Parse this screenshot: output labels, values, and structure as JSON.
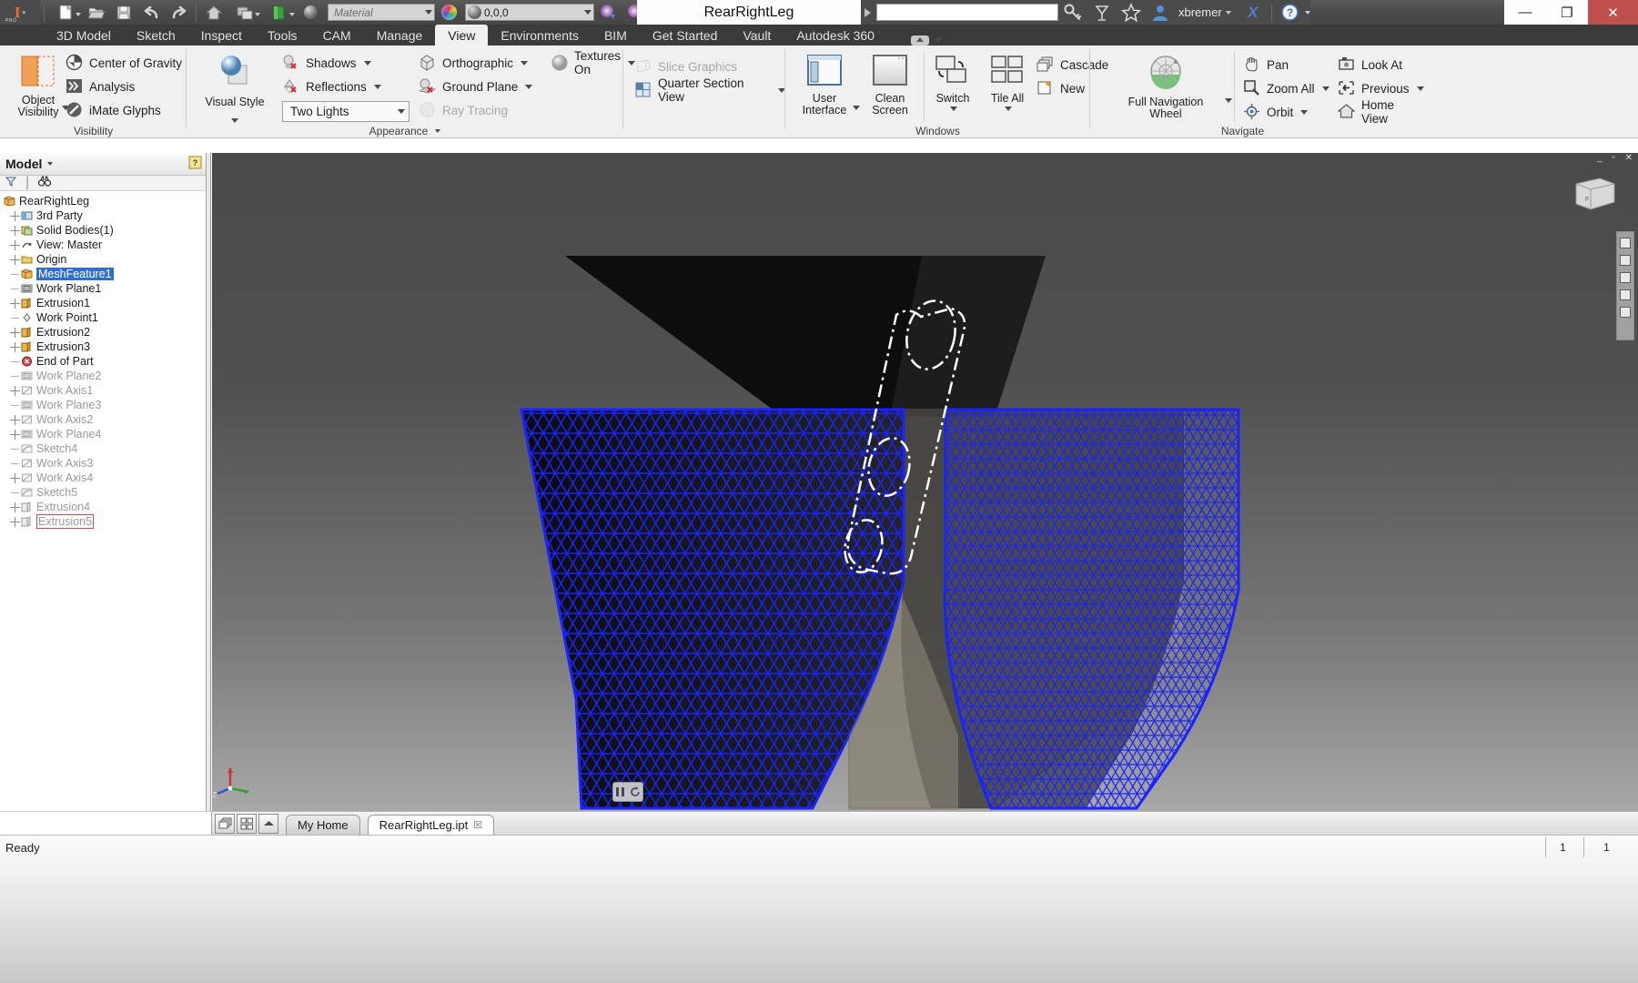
{
  "app": {
    "title": "RearRightLeg",
    "user": "xbremer",
    "status": "Ready"
  },
  "titlebar": {
    "logo": "inventor-logo",
    "logo_text": "I",
    "logo_sub": "PRO",
    "qat": [
      {
        "name": "new-file",
        "icon": "document-icon",
        "dropdown": true
      },
      {
        "name": "open-file",
        "icon": "folder-open-icon",
        "dropdown": false
      },
      {
        "name": "save-file",
        "icon": "floppy-disk-icon",
        "dropdown": false
      },
      {
        "name": "undo",
        "icon": "undo-arrow-icon",
        "dropdown": false
      },
      {
        "name": "redo",
        "icon": "redo-arrow-icon",
        "dropdown": false
      },
      {
        "name": "home",
        "icon": "home-icon",
        "dropdown": false
      },
      {
        "name": "return",
        "icon": "return-icon",
        "dropdown": true
      },
      {
        "name": "update",
        "icon": "green-book-icon",
        "dropdown": true
      },
      {
        "name": "material-sphere",
        "icon": "globe-icon",
        "dropdown": false
      }
    ],
    "material_value": "Material",
    "appearance_value": "0,0,0",
    "adjust_icons": [
      {
        "name": "clear-appearance-override",
        "icon": "color-eyedropper-icon"
      },
      {
        "name": "remove-appearance",
        "icon": "color-x-icon"
      },
      {
        "name": "parameters",
        "icon": "fx-icon"
      },
      {
        "name": "add-to-quick-access",
        "icon": "plus-icon"
      },
      {
        "name": "customize-quick-access",
        "icon": "overflow-icon"
      }
    ],
    "search_placeholder": "",
    "search_value": "",
    "right_icons": [
      {
        "name": "search-icon",
        "icon": "key-icon"
      },
      {
        "name": "connect-icon",
        "icon": "satellite-icon"
      },
      {
        "name": "favorites-icon",
        "icon": "star-icon"
      },
      {
        "name": "account-icon",
        "icon": "person-icon"
      },
      {
        "name": "exchange-apps-icon",
        "icon": "x-logo-icon"
      },
      {
        "name": "help-icon",
        "icon": "question-circle-icon"
      }
    ],
    "window_buttons": {
      "minimize": "—",
      "maximize": "❐",
      "close": "✕"
    }
  },
  "ribbon": {
    "tabs": [
      {
        "label": "3D Model",
        "active": false
      },
      {
        "label": "Sketch",
        "active": false
      },
      {
        "label": "Inspect",
        "active": false
      },
      {
        "label": "Tools",
        "active": false
      },
      {
        "label": "CAM",
        "active": false
      },
      {
        "label": "Manage",
        "active": false
      },
      {
        "label": "View",
        "active": true
      },
      {
        "label": "Environments",
        "active": false
      },
      {
        "label": "BIM",
        "active": false
      },
      {
        "label": "Get Started",
        "active": false
      },
      {
        "label": "Vault",
        "active": false
      },
      {
        "label": "Autodesk 360",
        "active": false
      }
    ],
    "panels": [
      {
        "name": "visibility",
        "label": "Visibility",
        "big_button": {
          "line1": "Object",
          "line2": "Visibility",
          "icon": "object-visibility-icon",
          "dropdown": true
        },
        "items": [
          {
            "label": "Center of Gravity",
            "icon": "center-of-gravity-icon",
            "dropdown": false,
            "disabled": false
          },
          {
            "label": "Analysis",
            "icon": "analysis-icon",
            "dropdown": false,
            "disabled": false
          },
          {
            "label": "iMate Glyphs",
            "icon": "imate-glyphs-icon",
            "dropdown": false,
            "disabled": false
          }
        ]
      },
      {
        "name": "appearance",
        "label": "Appearance",
        "label_dropdown": true,
        "big_button": {
          "line1": "Visual Style",
          "line2": "",
          "icon": "visual-style-icon",
          "dropdown": true
        },
        "items": [
          {
            "label": "Shadows",
            "icon": "shadows-icon",
            "dropdown": true,
            "disabled": false
          },
          {
            "label": "Reflections",
            "icon": "reflections-icon",
            "dropdown": true,
            "disabled": false
          },
          {
            "label": "Orthographic",
            "icon": "orthographic-icon",
            "dropdown": true,
            "disabled": false
          },
          {
            "label": "Ground Plane",
            "icon": "ground-plane-icon",
            "dropdown": true,
            "disabled": false
          },
          {
            "label": "Textures On",
            "icon": "textures-icon",
            "dropdown": true,
            "disabled": false
          },
          {
            "label": "Ray Tracing",
            "icon": "ray-tracing-icon",
            "dropdown": false,
            "disabled": true
          }
        ],
        "lights_combo": "Two Lights"
      },
      {
        "name": "sectioning",
        "label": "",
        "items": [
          {
            "label": "Slice Graphics",
            "icon": "slice-graphics-icon",
            "dropdown": false,
            "disabled": true
          },
          {
            "label": "Quarter Section View",
            "icon": "quarter-section-view-icon",
            "dropdown": true,
            "disabled": false
          }
        ]
      },
      {
        "name": "windows",
        "label": "Windows",
        "big_buttons": [
          {
            "line1": "User",
            "line2": "Interface",
            "icon": "user-interface-icon",
            "dropdown": true
          },
          {
            "line1": "Clean",
            "line2": "Screen",
            "icon": "clean-screen-icon",
            "dropdown": false
          },
          {
            "line1": "Switch",
            "line2": "",
            "icon": "switch-windows-icon",
            "dropdown": true
          },
          {
            "line1": "Tile All",
            "line2": "",
            "icon": "tile-all-icon",
            "dropdown": true
          }
        ],
        "items": [
          {
            "label": "Cascade",
            "icon": "cascade-icon",
            "dropdown": false,
            "disabled": false
          },
          {
            "label": "New",
            "icon": "new-window-icon",
            "dropdown": false,
            "disabled": false
          }
        ]
      },
      {
        "name": "navigate",
        "label": "Navigate",
        "big_button": {
          "line1": "Full Navigation",
          "line2": "Wheel",
          "icon": "navigation-wheel-icon",
          "dropdown": true
        },
        "items_col1": [
          {
            "label": "Pan",
            "icon": "pan-hand-icon",
            "dropdown": false,
            "disabled": false
          },
          {
            "label": "Zoom All",
            "icon": "zoom-all-icon",
            "dropdown": true,
            "disabled": false
          },
          {
            "label": "Orbit",
            "icon": "orbit-icon",
            "dropdown": true,
            "disabled": false
          }
        ],
        "items_col2": [
          {
            "label": "Look At",
            "icon": "look-at-icon",
            "dropdown": false,
            "disabled": false
          },
          {
            "label": "Previous",
            "icon": "previous-view-icon",
            "dropdown": true,
            "disabled": false
          },
          {
            "label": "Home View",
            "icon": "home-view-icon",
            "dropdown": true,
            "disabled": false
          }
        ]
      }
    ]
  },
  "browser": {
    "title": "Model",
    "title_dropdown": true,
    "help_icon": "help-book-icon",
    "toolbar": [
      {
        "name": "filter-icon",
        "icon": "funnel-icon"
      },
      {
        "name": "find-icon",
        "icon": "binoculars-icon"
      }
    ],
    "tree": [
      {
        "label": "RearRightLeg",
        "depth": 0,
        "expander": "none",
        "icon": "part-icon",
        "state": "normal"
      },
      {
        "label": "3rd Party",
        "depth": 1,
        "expander": "plus",
        "icon": "third-party-icon",
        "state": "normal"
      },
      {
        "label": "Solid Bodies(1)",
        "depth": 1,
        "expander": "plus",
        "icon": "solid-bodies-icon",
        "state": "normal"
      },
      {
        "label": "View: Master",
        "depth": 1,
        "expander": "plus",
        "icon": "view-icon",
        "state": "normal"
      },
      {
        "label": "Origin",
        "depth": 1,
        "expander": "plus",
        "icon": "folder-icon",
        "state": "normal"
      },
      {
        "label": "MeshFeature1",
        "depth": 1,
        "expander": "dash",
        "icon": "mesh-feature-icon",
        "state": "selected"
      },
      {
        "label": "Work Plane1",
        "depth": 1,
        "expander": "dash",
        "icon": "work-plane-icon",
        "state": "normal"
      },
      {
        "label": "Extrusion1",
        "depth": 1,
        "expander": "plus",
        "icon": "extrusion-icon",
        "state": "normal"
      },
      {
        "label": "Work Point1",
        "depth": 1,
        "expander": "dash",
        "icon": "work-point-icon",
        "state": "normal"
      },
      {
        "label": "Extrusion2",
        "depth": 1,
        "expander": "plus",
        "icon": "extrusion-icon",
        "state": "normal"
      },
      {
        "label": "Extrusion3",
        "depth": 1,
        "expander": "plus",
        "icon": "extrusion-icon",
        "state": "normal"
      },
      {
        "label": "End of Part",
        "depth": 1,
        "expander": "dash",
        "icon": "end-of-part-icon",
        "state": "normal"
      },
      {
        "label": "Work Plane2",
        "depth": 1,
        "expander": "dash",
        "icon": "work-plane-icon",
        "state": "greyed"
      },
      {
        "label": "Work Axis1",
        "depth": 1,
        "expander": "plus",
        "icon": "work-axis-icon",
        "state": "greyed"
      },
      {
        "label": "Work Plane3",
        "depth": 1,
        "expander": "dash",
        "icon": "work-plane-icon",
        "state": "greyed"
      },
      {
        "label": "Work Axis2",
        "depth": 1,
        "expander": "plus",
        "icon": "work-axis-icon",
        "state": "greyed"
      },
      {
        "label": "Work Plane4",
        "depth": 1,
        "expander": "plus",
        "icon": "work-plane-icon",
        "state": "greyed"
      },
      {
        "label": "Sketch4",
        "depth": 1,
        "expander": "dash",
        "icon": "sketch-icon",
        "state": "greyed"
      },
      {
        "label": "Work Axis3",
        "depth": 1,
        "expander": "dash",
        "icon": "work-axis-icon",
        "state": "greyed"
      },
      {
        "label": "Work Axis4",
        "depth": 1,
        "expander": "plus",
        "icon": "work-axis-icon",
        "state": "greyed"
      },
      {
        "label": "Sketch5",
        "depth": 1,
        "expander": "dash",
        "icon": "sketch-icon",
        "state": "greyed"
      },
      {
        "label": "Extrusion4",
        "depth": 1,
        "expander": "plus",
        "icon": "extrusion-icon",
        "state": "greyed"
      },
      {
        "label": "Extrusion5",
        "depth": 1,
        "expander": "plus",
        "icon": "extrusion-icon",
        "state": "outlined"
      }
    ]
  },
  "viewport": {
    "name": "3d-graphics-window",
    "viewcube_label": "FRONT",
    "model_description": "RearRightLeg part with blue triangulated mesh overlay and dark solid body",
    "mesh_color": "#1a22ff",
    "solid_color": "#121212",
    "background_top": "#4a4a4a",
    "background_bottom": "#a5a5a5"
  },
  "doctabs": {
    "tools": [
      {
        "name": "cascade-tabs-button",
        "icon": "cascade-icon"
      },
      {
        "name": "tile-tabs-button",
        "icon": "grid-icon"
      },
      {
        "name": "scroll-tabs-button",
        "icon": "chevron-up-icon"
      }
    ],
    "tabs": [
      {
        "label": "My Home",
        "active": false,
        "closable": false
      },
      {
        "label": "RearRightLeg.ipt",
        "active": true,
        "closable": true,
        "close": "☒"
      }
    ]
  },
  "statusbar": {
    "text": "Ready",
    "cells": [
      {
        "name": "status-count-1",
        "value": "1"
      },
      {
        "name": "status-count-2",
        "value": "1"
      }
    ]
  }
}
